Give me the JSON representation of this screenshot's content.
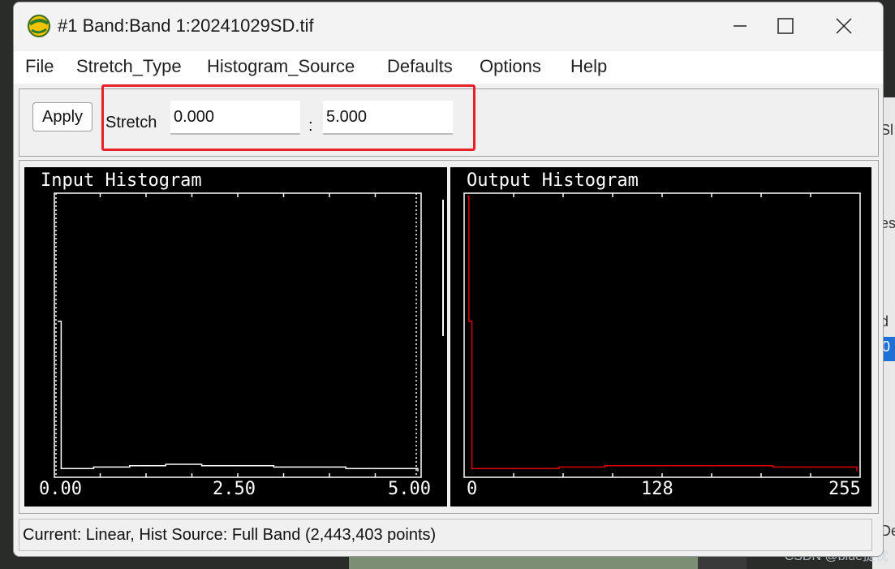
{
  "window": {
    "title": "#1 Band:Band 1:20241029SD.tif"
  },
  "menu": {
    "items": [
      "File",
      "Stretch_Type",
      "Histogram_Source",
      "Defaults",
      "Options",
      "Help"
    ]
  },
  "toolbar": {
    "apply_label": "Apply",
    "stretch_label": "Stretch",
    "stretch_min": "0.000",
    "separator": ":",
    "stretch_max": "5.000"
  },
  "input_histogram": {
    "title": "Input Histogram",
    "tick_labels": [
      "0.00",
      "2.50",
      "5.00"
    ]
  },
  "output_histogram": {
    "title": "Output Histogram",
    "tick_labels": [
      "0",
      "128",
      "255"
    ]
  },
  "status": {
    "text": "Current: Linear, Hist Source: Full Band (2,443,403 points)"
  },
  "background": {
    "fragments": [
      "Sl",
      "es",
      "d",
      "0",
      "De"
    ]
  },
  "watermark": "CSDN @blue提枕",
  "colors": {
    "highlight": "#e8202a",
    "output_curve": "#e00000",
    "plot_bg": "#000000",
    "plot_fg": "#ffffff"
  },
  "chart_data": [
    {
      "type": "line",
      "title": "Input Histogram",
      "x_range": [
        0,
        5
      ],
      "x_ticks": [
        "0.00",
        "2.50",
        "5.00"
      ],
      "stretch_markers": [
        0.0,
        5.0
      ],
      "points": [
        [
          0,
          0.55
        ],
        [
          0.05,
          0.02
        ],
        [
          0.4,
          0.02
        ],
        [
          0.5,
          0.025
        ],
        [
          1.0,
          0.03
        ],
        [
          1.5,
          0.035
        ],
        [
          2.0,
          0.03
        ],
        [
          3.0,
          0.025
        ],
        [
          4.0,
          0.02
        ],
        [
          5.0,
          0.01
        ]
      ]
    },
    {
      "type": "line",
      "title": "Output Histogram",
      "x_range": [
        0,
        255
      ],
      "x_ticks": [
        "0",
        "128",
        "255"
      ],
      "points": [
        [
          0,
          1.0
        ],
        [
          1,
          0.55
        ],
        [
          3,
          0.02
        ],
        [
          30,
          0.02
        ],
        [
          60,
          0.025
        ],
        [
          90,
          0.03
        ],
        [
          140,
          0.03
        ],
        [
          200,
          0.025
        ],
        [
          255,
          0.01
        ]
      ]
    }
  ]
}
